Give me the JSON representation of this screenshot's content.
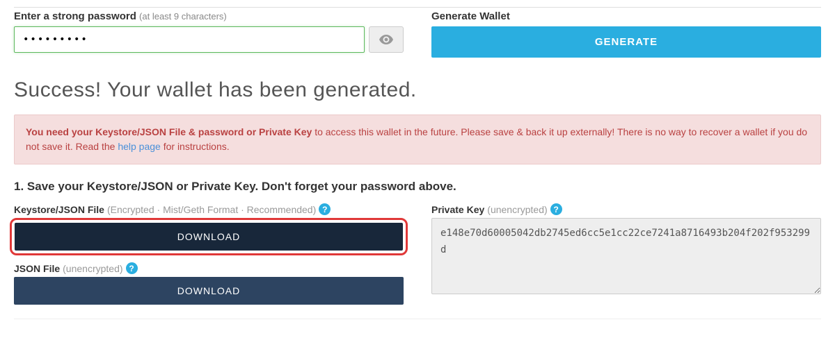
{
  "password_section": {
    "label": "Enter a strong password",
    "label_sub": "(at least 9 characters)",
    "value": "•••••••••"
  },
  "generate_section": {
    "label": "Generate Wallet",
    "button_label": "GENERATE"
  },
  "success": {
    "heading": "Success! Your wallet has been generated."
  },
  "alert": {
    "strong": "You need your Keystore/JSON File & password or Private Key",
    "text1": " to access this wallet in the future. Please save & back it up externally! There is no way to recover a wallet if you do not save it. Read the ",
    "link": "help page",
    "text2": " for instructions."
  },
  "step1": {
    "title": "1. Save your Keystore/JSON or Private Key. Don't forget your password above.",
    "keystore_label": "Keystore/JSON File",
    "keystore_sub": "(Encrypted · Mist/Geth Format · Recommended)",
    "json_label": "JSON File",
    "json_sub": "(unencrypted)",
    "download_label": "DOWNLOAD",
    "privatekey_label": "Private Key",
    "privatekey_sub": "(unencrypted)",
    "privatekey_value": "e148e70d60005042db2745ed6cc5e1cc22ce7241a8716493b204f202f953299d"
  },
  "icons": {
    "help": "?"
  }
}
